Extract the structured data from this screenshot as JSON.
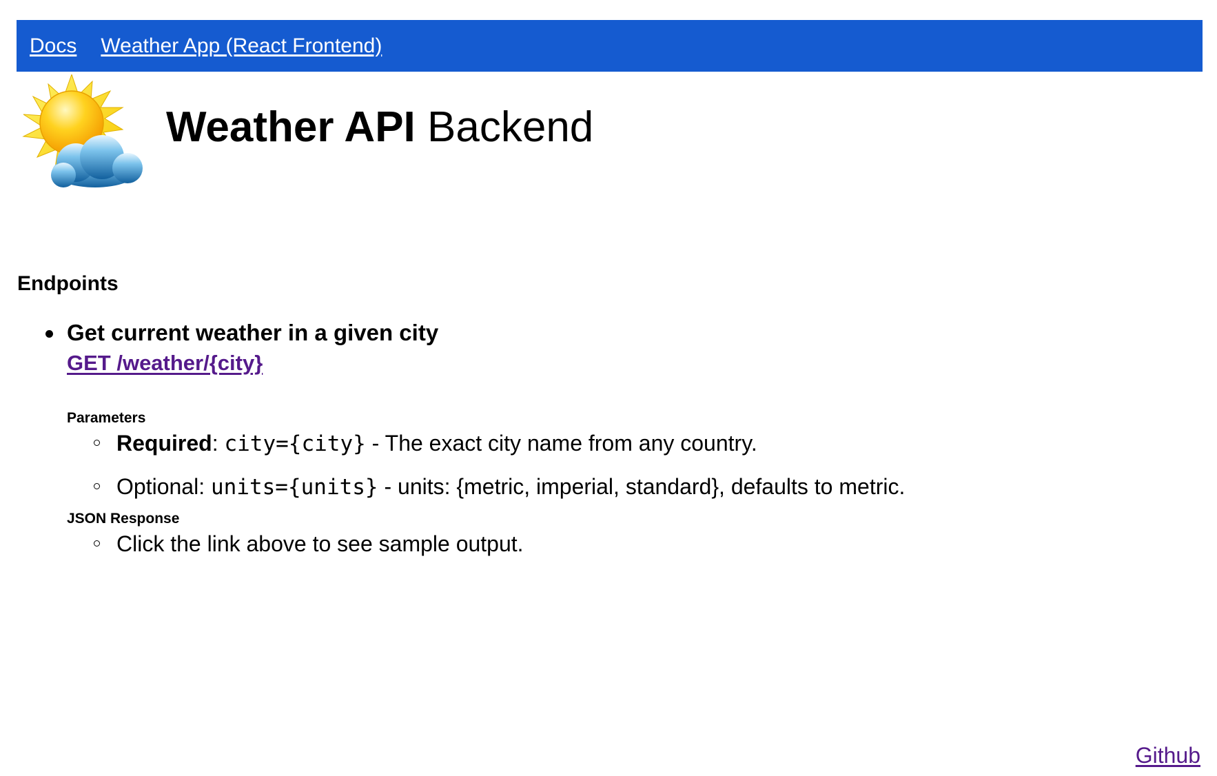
{
  "nav": {
    "links": [
      {
        "label": "Docs"
      },
      {
        "label": "Weather App (React Frontend)"
      }
    ]
  },
  "header": {
    "logo_icon": "sun-behind-cloud-icon",
    "title_bold": "Weather API",
    "title_rest": " Backend"
  },
  "endpoints": {
    "heading": "Endpoints",
    "items": [
      {
        "description": "Get current weather in a given city",
        "link": "GET /weather/{city}",
        "parameters_heading": "Parameters",
        "required": {
          "label": "Required",
          "separator": ": ",
          "code": "city={city}",
          "text": " - The exact city name from any country."
        },
        "optional": {
          "label": "Optional: ",
          "code": "units={units}",
          "text": " - units: {metric, imperial, standard}, defaults to metric."
        },
        "response_heading": "JSON Response",
        "response_note": "Click the link above to see sample output."
      }
    ]
  },
  "footer": {
    "github_label": "Github"
  },
  "colors": {
    "navbar": "#155bd0",
    "visited_link": "#551a8b"
  }
}
